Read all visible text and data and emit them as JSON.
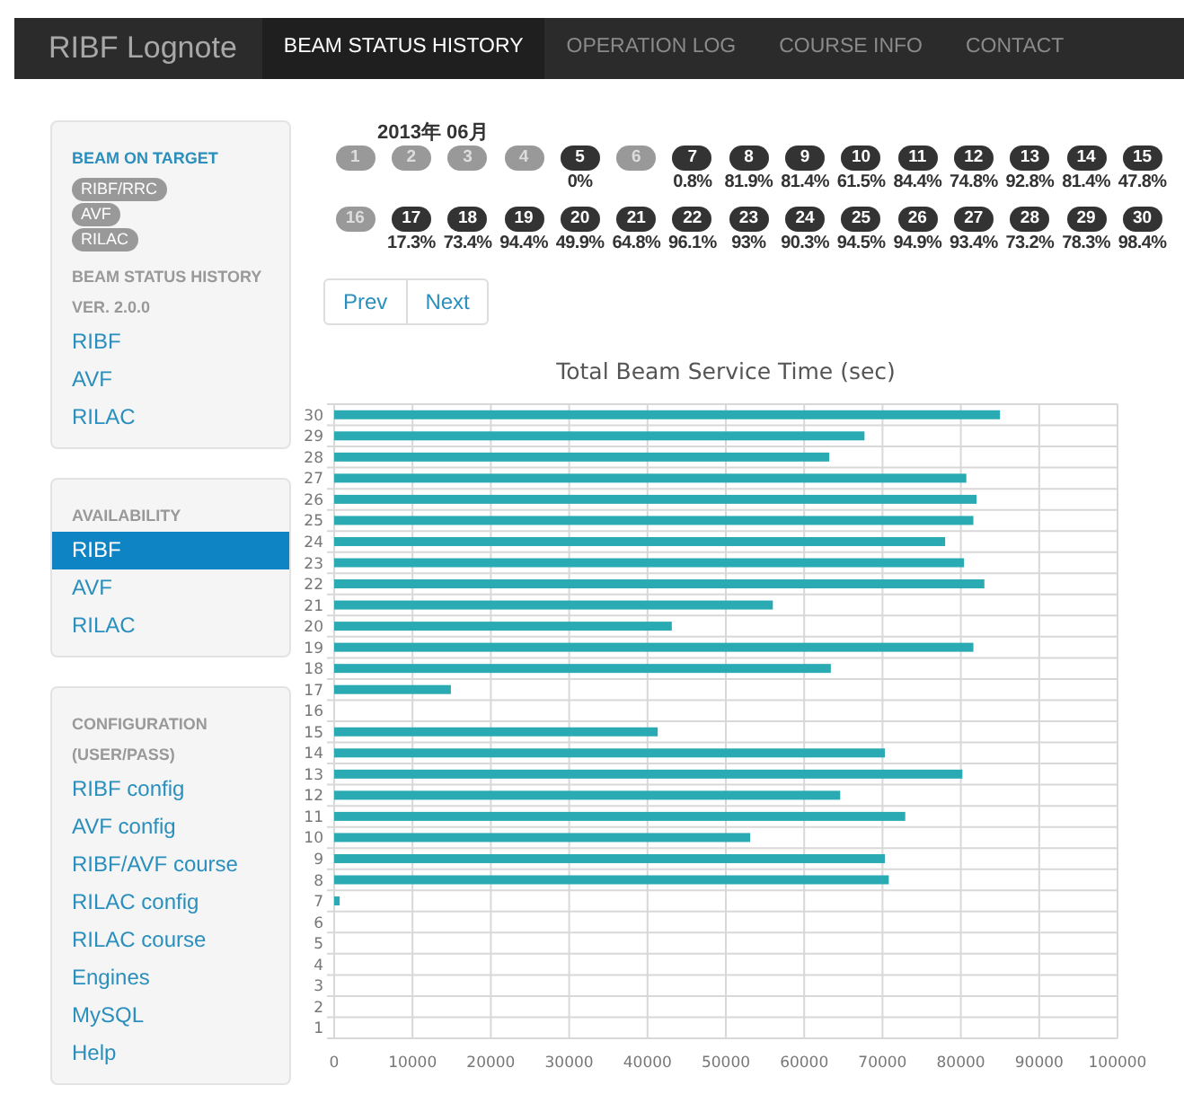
{
  "navbar": {
    "brand": "RIBF Lognote",
    "tabs": [
      {
        "label": "BEAM STATUS HISTORY",
        "selected": true
      },
      {
        "label": "OPERATION LOG",
        "selected": false
      },
      {
        "label": "COURSE INFO",
        "selected": false
      },
      {
        "label": "CONTACT",
        "selected": false
      }
    ]
  },
  "sidebar": [
    {
      "heading": "BEAM ON TARGET",
      "kind": "highlight",
      "badges": [
        "RIBF/RRC",
        "AVF",
        "RILAC"
      ],
      "subheadings": [
        "BEAM STATUS HISTORY",
        "VER. 2.0.0"
      ],
      "items": [
        {
          "label": "RIBF",
          "selected": false
        },
        {
          "label": "AVF",
          "selected": false
        },
        {
          "label": "RILAC",
          "selected": false
        }
      ]
    },
    {
      "heading": "AVAILABILITY",
      "kind": "plain",
      "items": [
        {
          "label": "RIBF",
          "selected": true
        },
        {
          "label": "AVF",
          "selected": false
        },
        {
          "label": "RILAC",
          "selected": false
        }
      ]
    },
    {
      "heading": "CONFIGURATION (USER/PASS)",
      "kind": "plain",
      "items": [
        {
          "label": "RIBF config",
          "selected": false
        },
        {
          "label": "AVF config",
          "selected": false
        },
        {
          "label": "RIBF/AVF course",
          "selected": false
        },
        {
          "label": "RILAC config",
          "selected": false
        },
        {
          "label": "RILAC course",
          "selected": false
        },
        {
          "label": "Engines",
          "selected": false
        },
        {
          "label": "MySQL",
          "selected": false
        },
        {
          "label": "Help",
          "selected": false
        }
      ]
    }
  ],
  "month": "2013年 06月",
  "days": [
    {
      "label": "1",
      "active": false
    },
    {
      "label": "2",
      "active": false
    },
    {
      "label": "3",
      "active": false
    },
    {
      "label": "4",
      "active": false
    },
    {
      "label": "5",
      "active": true,
      "percent": "0%"
    },
    {
      "label": "6",
      "active": false
    },
    {
      "label": "7",
      "active": true,
      "percent": "0.8%"
    },
    {
      "label": "8",
      "active": true,
      "percent": "81.9%"
    },
    {
      "label": "9",
      "active": true,
      "percent": "81.4%"
    },
    {
      "label": "10",
      "active": true,
      "percent": "61.5%"
    },
    {
      "label": "11",
      "active": true,
      "percent": "84.4%"
    },
    {
      "label": "12",
      "active": true,
      "percent": "74.8%"
    },
    {
      "label": "13",
      "active": true,
      "percent": "92.8%"
    },
    {
      "label": "14",
      "active": true,
      "percent": "81.4%"
    },
    {
      "label": "15",
      "active": true,
      "percent": "47.8%"
    },
    {
      "label": "16",
      "active": false
    },
    {
      "label": "17",
      "active": true,
      "percent": "17.3%"
    },
    {
      "label": "18",
      "active": true,
      "percent": "73.4%"
    },
    {
      "label": "19",
      "active": true,
      "percent": "94.4%"
    },
    {
      "label": "20",
      "active": true,
      "percent": "49.9%"
    },
    {
      "label": "21",
      "active": true,
      "percent": "64.8%"
    },
    {
      "label": "22",
      "active": true,
      "percent": "96.1%"
    },
    {
      "label": "23",
      "active": true,
      "percent": "93%"
    },
    {
      "label": "24",
      "active": true,
      "percent": "90.3%"
    },
    {
      "label": "25",
      "active": true,
      "percent": "94.5%"
    },
    {
      "label": "26",
      "active": true,
      "percent": "94.9%"
    },
    {
      "label": "27",
      "active": true,
      "percent": "93.4%"
    },
    {
      "label": "28",
      "active": true,
      "percent": "73.2%"
    },
    {
      "label": "29",
      "active": true,
      "percent": "78.3%"
    },
    {
      "label": "30",
      "active": true,
      "percent": "98.4%"
    }
  ],
  "pager": [
    "Prev",
    "Next"
  ],
  "chart_data": {
    "type": "bar",
    "orientation": "horizontal",
    "title": "Total Beam Service Time (sec)",
    "categories": [
      "30",
      "29",
      "28",
      "27",
      "26",
      "25",
      "24",
      "23",
      "22",
      "21",
      "20",
      "19",
      "18",
      "17",
      "16",
      "15",
      "14",
      "13",
      "12",
      "11",
      "10",
      "9",
      "8",
      "7",
      "6",
      "5",
      "4",
      "3",
      "2",
      "1"
    ],
    "series": [
      {
        "color": "#2aabb3",
        "values": [
          85000,
          67700,
          63200,
          80700,
          82000,
          81600,
          78000,
          80400,
          83000,
          56000,
          43100,
          81600,
          63400,
          14900,
          null,
          41300,
          70300,
          80200,
          64600,
          72900,
          53100,
          70300,
          70800,
          700,
          null,
          0,
          null,
          null,
          null,
          null
        ]
      }
    ],
    "grid": true,
    "xlim": [
      0,
      100000
    ],
    "xticks": [
      0,
      10000,
      20000,
      30000,
      40000,
      50000,
      60000,
      70000,
      80000,
      90000,
      100000
    ]
  }
}
